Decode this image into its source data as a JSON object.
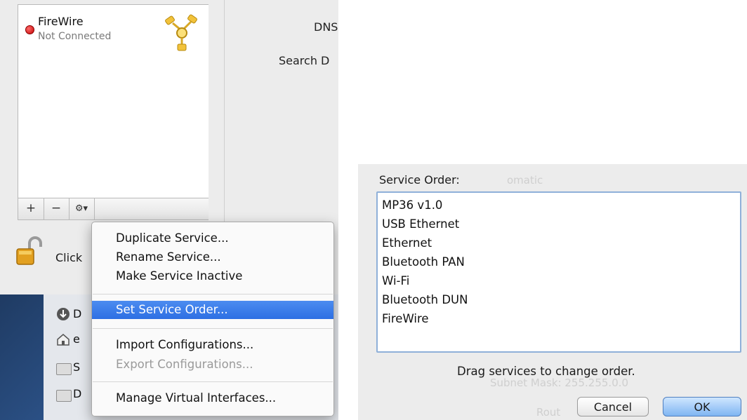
{
  "network_panel": {
    "services": [
      {
        "name": "FireWire",
        "status": "Not Connected",
        "status_color": "#d40000"
      }
    ],
    "toolbar": {
      "add_label": "+",
      "remove_label": "−",
      "action_label": "⚙▾"
    },
    "labels": {
      "dns": "DNS",
      "search": "Search D"
    },
    "lock_text": "Click"
  },
  "context_menu": {
    "items": [
      {
        "label": "Duplicate Service...",
        "state": "normal"
      },
      {
        "label": "Rename Service...",
        "state": "normal"
      },
      {
        "label": "Make Service Inactive",
        "state": "normal"
      },
      {
        "label": "Set Service Order...",
        "state": "highlighted"
      },
      {
        "label": "Import Configurations...",
        "state": "normal"
      },
      {
        "label": "Export Configurations...",
        "state": "disabled"
      },
      {
        "label": "Manage Virtual Interfaces...",
        "state": "normal"
      }
    ],
    "highlight_color": "#3a7ae8"
  },
  "finder_sidebar": {
    "items": [
      "D",
      "e",
      "S",
      "D"
    ]
  },
  "service_order_dialog": {
    "title": "Service Order:",
    "services": [
      "MP36 v1.0",
      "USB Ethernet",
      "Ethernet",
      "Bluetooth PAN",
      "Wi-Fi",
      "Bluetooth DUN",
      "FireWire"
    ],
    "hint": "Drag services to change order.",
    "cancel_label": "Cancel",
    "ok_label": "OK",
    "background_text": {
      "top": "omatic",
      "subnet": "Subnet Mask:  255.255.0.0",
      "router": "Rout"
    }
  }
}
